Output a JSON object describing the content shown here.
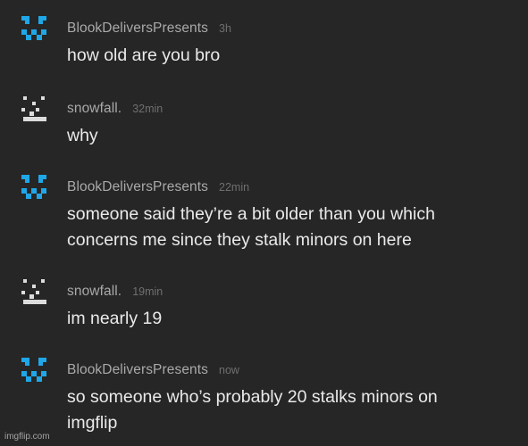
{
  "comments": [
    {
      "username": "BlookDeliversPresents",
      "time": "3h",
      "lines": [
        "how old are you bro"
      ],
      "avatar_icon": "blue-pixel-face-icon"
    },
    {
      "username": "snowfall.",
      "time": "32min",
      "lines": [
        "why"
      ],
      "avatar_icon": "gray-pixel-face-icon"
    },
    {
      "username": "BlookDeliversPresents",
      "time": "22min",
      "lines": [
        "someone said they’re a bit older than you which",
        "concerns me since they stalk minors on here"
      ],
      "avatar_icon": "blue-pixel-face-icon"
    },
    {
      "username": "snowfall.",
      "time": "19min",
      "lines": [
        "im nearly 19"
      ],
      "avatar_icon": "gray-pixel-face-icon"
    },
    {
      "username": "BlookDeliversPresents",
      "time": "now",
      "lines": [
        "so someone who’s probably 20 stalks minors on",
        "imgflip"
      ],
      "avatar_icon": "blue-pixel-face-icon"
    }
  ],
  "watermark": "imgflip.com",
  "colors": {
    "background": "#262626",
    "username": "#a9a9a9",
    "timestamp": "#6f6f6f",
    "body_text": "#eaeaea",
    "avatar_blue": "#1fa7e8",
    "avatar_gray": "#dcdcdc"
  }
}
